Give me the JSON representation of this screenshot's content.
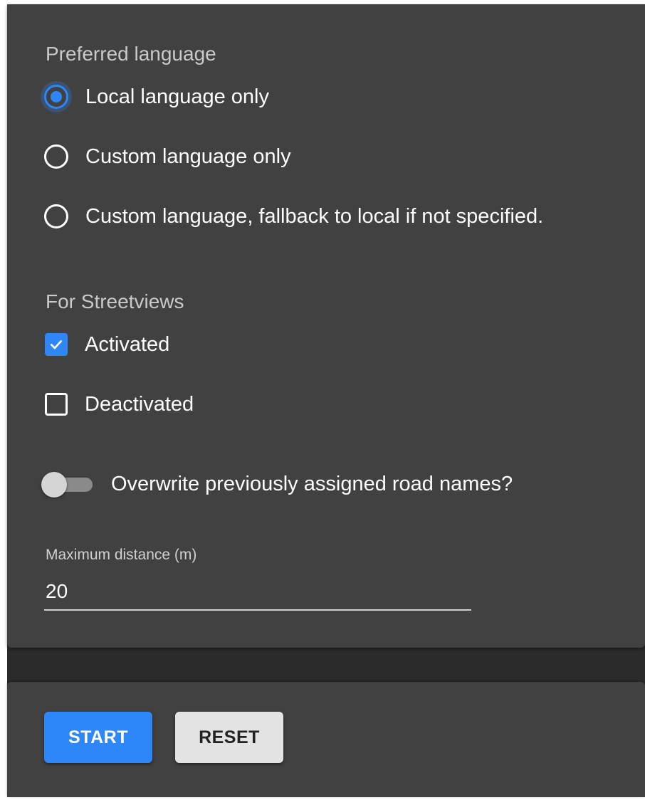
{
  "preferred_language": {
    "title": "Preferred language",
    "options": [
      {
        "label": "Local language only",
        "checked": true
      },
      {
        "label": "Custom language only",
        "checked": false
      },
      {
        "label": "Custom language, fallback to local if not specified.",
        "checked": false
      }
    ]
  },
  "streetviews": {
    "title": "For Streetviews",
    "options": [
      {
        "label": "Activated",
        "checked": true
      },
      {
        "label": "Deactivated",
        "checked": false
      }
    ]
  },
  "overwrite_toggle": {
    "label": "Overwrite previously assigned road names?",
    "on": false
  },
  "max_distance": {
    "label": "Maximum distance (m)",
    "value": "20"
  },
  "actions": {
    "start_label": "START",
    "reset_label": "RESET"
  },
  "colors": {
    "accent": "#2f86f6",
    "card_background": "#414141",
    "page_background": "#2b2b2b"
  },
  "icons": {
    "radio_checked": "radio-checked-icon",
    "radio_unchecked": "radio-unchecked-icon",
    "checkbox_checked": "checkbox-checked-icon",
    "checkbox_unchecked": "checkbox-unchecked-icon"
  }
}
